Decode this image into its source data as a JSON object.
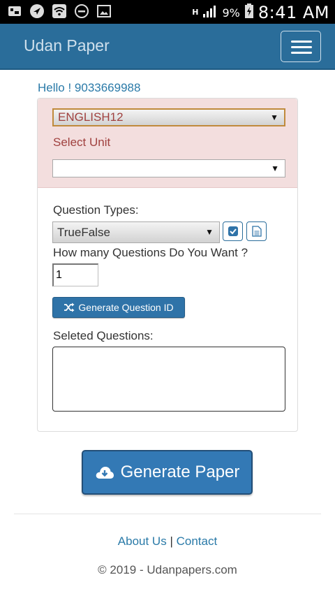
{
  "status_bar": {
    "network_label": "H",
    "battery_percent": "9%",
    "time": "8:41 AM",
    "icons": [
      "gallery-icon",
      "navigation-icon",
      "wifi-icon",
      "do-not-disturb-icon",
      "image-icon",
      "signal-icon",
      "battery-icon"
    ]
  },
  "navbar": {
    "brand": "Udan Paper",
    "menu_icon": "hamburger-icon"
  },
  "greeting": "Hello ! 9033669988",
  "form": {
    "subject_selected": "ENGLISH12",
    "unit_label": "Select Unit",
    "unit_selected": "",
    "question_types_label": "Question Types:",
    "question_type_selected": "TrueFalse",
    "how_many_label": "How many Questions Do You Want ?",
    "how_many_value": "1",
    "generate_id_label": "Generate Question ID",
    "selected_questions_label": "Seleted Questions:",
    "selected_questions_value": ""
  },
  "generate_paper_label": "Generate Paper",
  "footer": {
    "about": "About Us",
    "separator": "|",
    "contact": "Contact",
    "copyright": "© 2019 - Udanpapers.com"
  },
  "colors": {
    "navbar": "#2a6d9a",
    "accent": "#3379b5",
    "panel_head": "#f3dede",
    "danger_text": "#a0413f",
    "link": "#2a7aa8"
  }
}
